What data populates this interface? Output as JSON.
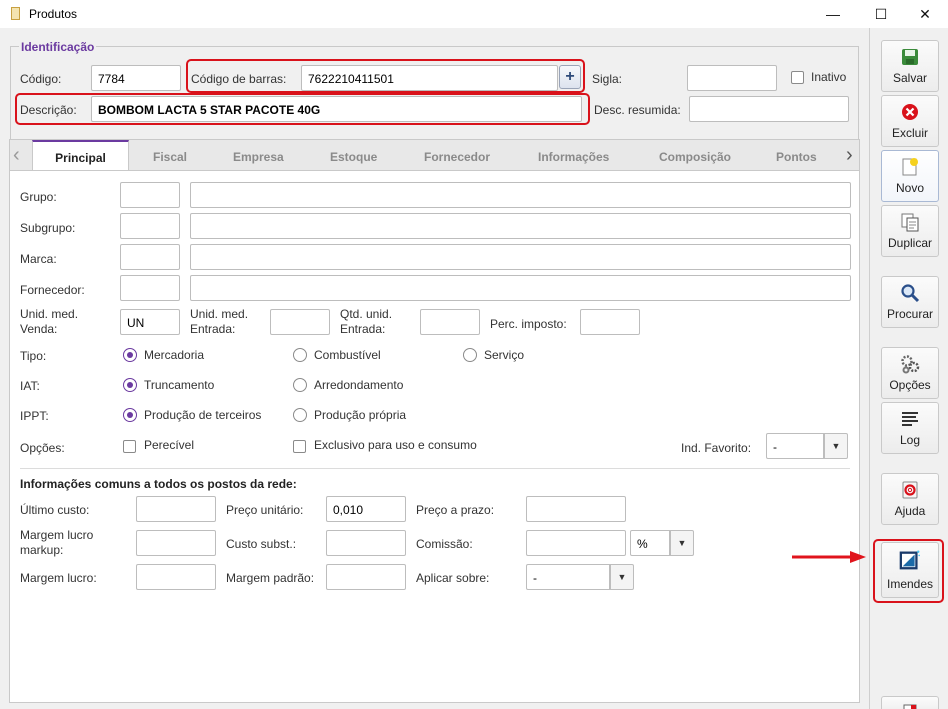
{
  "window": {
    "title": "Produtos",
    "minimize": "—",
    "maximize": "☐",
    "close": "✕"
  },
  "identificacao": {
    "legend": "Identificação",
    "codigo_label": "Código:",
    "codigo_value": "7784",
    "barras_label": "Código de barras:",
    "barras_value": "7622210411501",
    "plus_icon": "+",
    "sigla_label": "Sigla:",
    "sigla_value": "",
    "inativo_label": "Inativo",
    "descricao_label": "Descrição:",
    "descricao_value": "BOMBOM LACTA 5 STAR PACOTE 40G",
    "desc_resumida_label": "Desc. resumida:",
    "desc_resumida_value": ""
  },
  "tabs": [
    "Principal",
    "Fiscal",
    "Empresa",
    "Estoque",
    "Fornecedor",
    "Informações",
    "Composição",
    "Pontos"
  ],
  "principal": {
    "grupo_label": "Grupo:",
    "subgrupo_label": "Subgrupo:",
    "marca_label": "Marca:",
    "fornecedor_label": "Fornecedor:",
    "unid_venda_label": "Unid. med. Venda:",
    "unid_venda_value": "UN",
    "unid_entrada_label": "Unid. med. Entrada:",
    "qtd_entrada_label": "Qtd. unid. Entrada:",
    "perc_imposto_label": "Perc. imposto:",
    "tipo_label": "Tipo:",
    "tipo_options": [
      "Mercadoria",
      "Combustível",
      "Serviço"
    ],
    "iat_label": "IAT:",
    "iat_options": [
      "Truncamento",
      "Arredondamento"
    ],
    "ippt_label": "IPPT:",
    "ippt_options": [
      "Produção de terceiros",
      "Produção própria"
    ],
    "opcoes_label": "Opções:",
    "opcoes_checks": [
      "Perecível",
      "Exclusivo para uso e consumo"
    ],
    "favorito_label": "Ind. Favorito:",
    "favorito_value": "-",
    "rede_title": "Informações comuns a todos os postos da rede:",
    "ultimo_custo_label": "Último custo:",
    "preco_unitario_label": "Preço unitário:",
    "preco_unitario_value": "0,010",
    "preco_prazo_label": "Preço a prazo:",
    "margem_markup_label": "Margem lucro markup:",
    "custo_subst_label": "Custo subst.:",
    "comissao_label": "Comissão:",
    "comissao_unit": "%",
    "margem_lucro_label": "Margem lucro:",
    "margem_padrao_label": "Margem padrão:",
    "aplicar_label": "Aplicar sobre:",
    "aplicar_value": "-"
  },
  "sidebar": {
    "buttons": [
      {
        "label": "Salvar",
        "icon": "save-icon"
      },
      {
        "label": "Excluir",
        "icon": "delete-icon"
      },
      {
        "label": "Novo",
        "icon": "new-icon"
      },
      {
        "label": "Duplicar",
        "icon": "duplicate-icon"
      },
      {
        "label": "Procurar",
        "icon": "search-icon"
      },
      {
        "label": "Opções",
        "icon": "gears-icon"
      },
      {
        "label": "Log",
        "icon": "log-icon"
      },
      {
        "label": "Ajuda",
        "icon": "help-icon"
      },
      {
        "label": "Imendes",
        "icon": "imendes-icon"
      }
    ]
  },
  "colors": {
    "accent": "#6b3aa0",
    "highlight": "#d9121b"
  }
}
